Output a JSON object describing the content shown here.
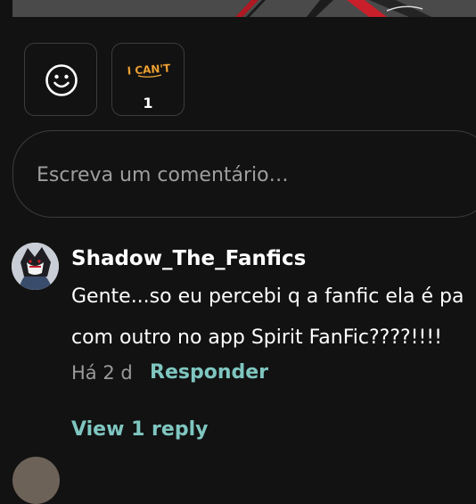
{
  "reactions": [
    {
      "icon": "smiley-icon",
      "count": ""
    },
    {
      "icon": "icant-sticker",
      "sticker_text": "I CAN'T",
      "count": "1"
    }
  ],
  "comment_input": {
    "placeholder": "Escreva um comentário…"
  },
  "comment": {
    "username": "Shadow_The_Fanfics",
    "text_line1": "Gente...so eu percebi q a fanfic ela é pa",
    "text_line2": "com outro no app Spirit FanFic????!!!!",
    "timestamp": "Há 2 d",
    "reply_label": "Responder",
    "view_replies_label": "View 1 reply"
  },
  "next_comment": {
    "username": ""
  },
  "colors": {
    "background": "#121212",
    "border": "#3c3c3c",
    "accent": "#7fc6c0",
    "muted": "#9a9a9a",
    "sticker": "#f2a93b"
  }
}
